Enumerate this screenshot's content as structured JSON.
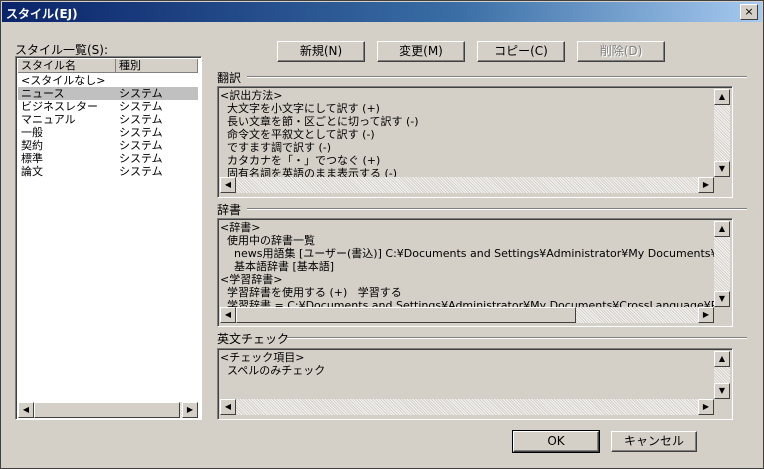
{
  "window": {
    "title": "スタイル(EJ)",
    "close_label": "×"
  },
  "style_list": {
    "label": "スタイル一覧(S):",
    "columns": [
      "スタイル名",
      "種別"
    ],
    "rows": [
      {
        "name": "<スタイルなし>",
        "type": ""
      },
      {
        "name": "ニュース",
        "type": "システム"
      },
      {
        "name": "ビジネスレター",
        "type": "システム"
      },
      {
        "name": "マニュアル",
        "type": "システム"
      },
      {
        "name": "一般",
        "type": "システム"
      },
      {
        "name": "契約",
        "type": "システム"
      },
      {
        "name": "標準",
        "type": "システム"
      },
      {
        "name": "論文",
        "type": "システム"
      }
    ],
    "selected_index": 1
  },
  "toolbar": {
    "new_label": "新規(N)",
    "edit_label": "変更(M)",
    "copy_label": "コピー(C)",
    "delete_label": "削除(D)"
  },
  "translation": {
    "group_label": "翻訳",
    "lines": [
      "<訳出方法>",
      "  大文字を小文字にして訳す (+)",
      "  長い文章を節・区ごとに切って訳す (-)",
      "  命令文を平叙文として訳す (-)",
      "  ですます調で訳す (-)",
      "  カタカナを「・」でつなぐ (+)",
      "  固有名詞を英語のまま表示する (-)"
    ]
  },
  "dictionary": {
    "group_label": "辞書",
    "lines": [
      "<辞書>",
      "  使用中の辞書一覧",
      "    news用語集 [ユーザー(書込)] C:¥Documents and Settings¥Administrator¥My Documents¥CrossLanguage",
      "    基本語辞書 [基本語]",
      "<学習辞書>",
      "  学習辞書を使用する (+)   学習する",
      "  学習辞書 = C:¥Documents and Settings¥Administrator¥My Documents¥CrossLanguage¥PC¥ej¥"
    ]
  },
  "spellcheck": {
    "group_label": "英文チェック",
    "lines": [
      "<チェック項目>",
      "  スペルのみチェック"
    ]
  },
  "footer": {
    "ok_label": "OK",
    "cancel_label": "キャンセル"
  },
  "icons": {
    "up": "▲",
    "down": "▼",
    "left": "◀",
    "right": "▶"
  }
}
